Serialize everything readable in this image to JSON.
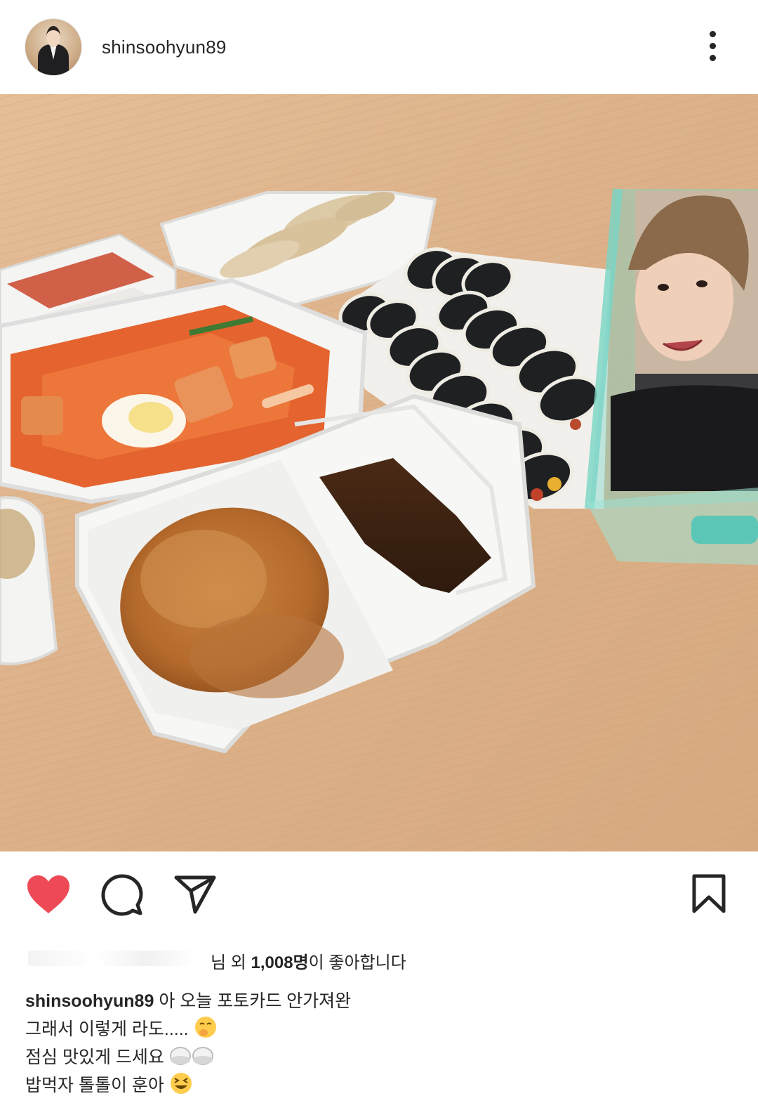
{
  "post": {
    "username": "shinsoohyun89"
  },
  "likes": {
    "suffix_before": "님 외 ",
    "count": "1,008명",
    "suffix_after": "이 좋아합니다"
  },
  "caption": {
    "username": "shinsoohyun89",
    "line1": " 아 오늘 포토카드 안가져완",
    "line2": "그래서 이렇게 라도.....",
    "line3": "점심 맛있게 드세요",
    "line4": "밥먹자 톨톨이 훈아"
  },
  "icons": {
    "like": "heart-icon",
    "comment": "comment-icon",
    "share": "send-icon",
    "save": "bookmark-icon",
    "more": "more-vertical-icon"
  },
  "colors": {
    "like_red": "#ed4956",
    "text": "#262626",
    "table": "#e1b78f"
  }
}
